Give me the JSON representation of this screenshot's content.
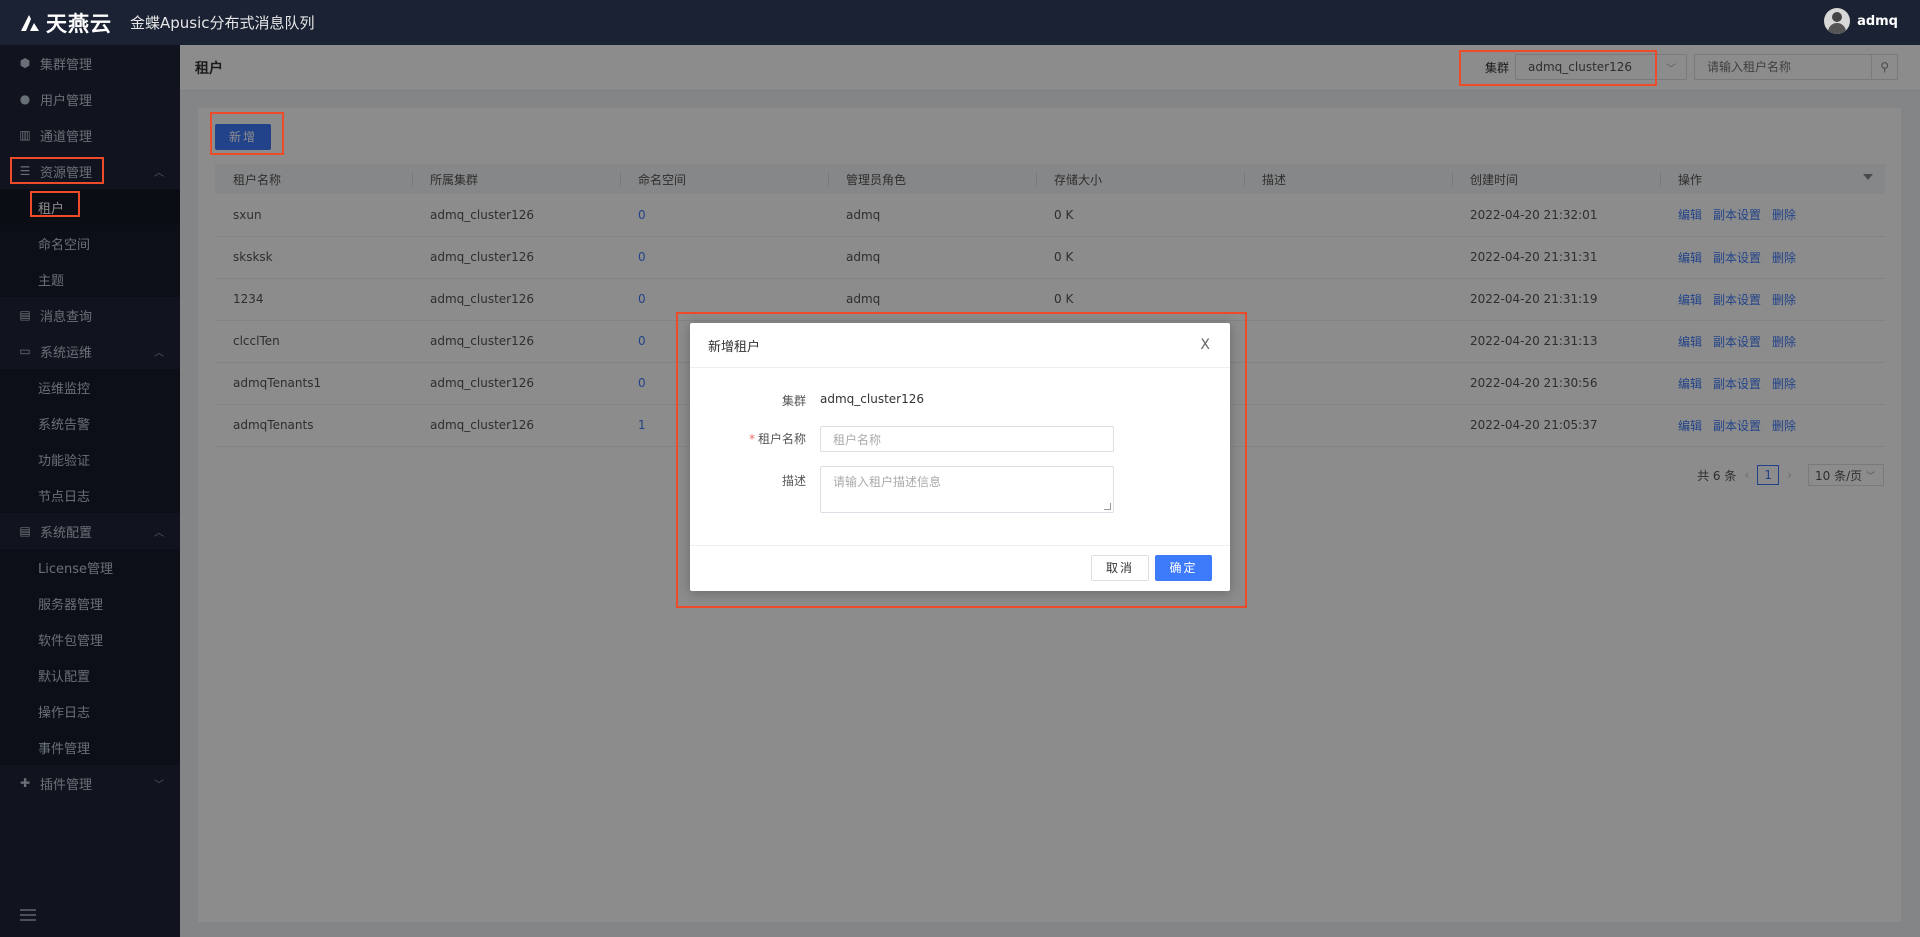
{
  "header": {
    "brand": "天燕云",
    "app_title": "金蝶Apusic分布式消息队列",
    "user_name": "admq"
  },
  "sidebar": {
    "items": [
      {
        "label": "集群管理",
        "icon": "cube-icon"
      },
      {
        "label": "用户管理",
        "icon": "user-icon"
      },
      {
        "label": "通道管理",
        "icon": "channel-icon"
      },
      {
        "label": "资源管理",
        "icon": "database-icon",
        "expanded": true,
        "children": [
          "租户",
          "命名空间",
          "主题"
        ]
      },
      {
        "label": "消息查询",
        "icon": "document-search-icon"
      },
      {
        "label": "系统运维",
        "icon": "monitor-icon",
        "expanded": true,
        "children": [
          "运维监控",
          "系统告警",
          "功能验证",
          "节点日志"
        ]
      },
      {
        "label": "系统配置",
        "icon": "list-icon",
        "expanded": true,
        "children": [
          "License管理",
          "服务器管理",
          "软件包管理",
          "默认配置",
          "操作日志",
          "事件管理"
        ]
      },
      {
        "label": "插件管理",
        "icon": "puzzle-icon",
        "expanded": false
      }
    ],
    "active_child": "租户"
  },
  "page": {
    "title": "租户",
    "cluster_label": "集群",
    "cluster_value": "admq_cluster126",
    "search_placeholder": "请输入租户名称",
    "add_button": "新增"
  },
  "table": {
    "columns": [
      "租户名称",
      "所属集群",
      "命名空间",
      "管理员角色",
      "存储大小",
      "描述",
      "创建时间",
      "操作"
    ],
    "rows": [
      {
        "name": "sxun",
        "cluster": "admq_cluster126",
        "ns": "0",
        "role": "admq",
        "size": "0 K",
        "desc": "",
        "created": "2022-04-20 21:32:01"
      },
      {
        "name": "sksksk",
        "cluster": "admq_cluster126",
        "ns": "0",
        "role": "admq",
        "size": "0 K",
        "desc": "",
        "created": "2022-04-20 21:31:31"
      },
      {
        "name": "1234",
        "cluster": "admq_cluster126",
        "ns": "0",
        "role": "admq",
        "size": "0 K",
        "desc": "",
        "created": "2022-04-20 21:31:19"
      },
      {
        "name": "clcclTen",
        "cluster": "admq_cluster126",
        "ns": "0",
        "role": "",
        "size": "",
        "desc": "",
        "created": "2022-04-20 21:31:13"
      },
      {
        "name": "admqTenants1",
        "cluster": "admq_cluster126",
        "ns": "0",
        "role": "",
        "size": "",
        "desc": "",
        "created": "2022-04-20 21:30:56"
      },
      {
        "name": "admqTenants",
        "cluster": "admq_cluster126",
        "ns": "1",
        "role": "",
        "size": "",
        "desc": "",
        "created": "2022-04-20 21:05:37"
      }
    ],
    "actions": [
      "编辑",
      "副本设置",
      "删除"
    ]
  },
  "pager": {
    "total": "共 6 条",
    "current": "1",
    "page_size": "10 条/页"
  },
  "dialog": {
    "title": "新增租户",
    "close": "X",
    "cluster_label": "集群",
    "cluster_value": "admq_cluster126",
    "name_label": "租户名称",
    "name_placeholder": "租户名称",
    "desc_label": "描述",
    "desc_placeholder": "请输入租户描述信息",
    "cancel": "取消",
    "ok": "确定"
  }
}
